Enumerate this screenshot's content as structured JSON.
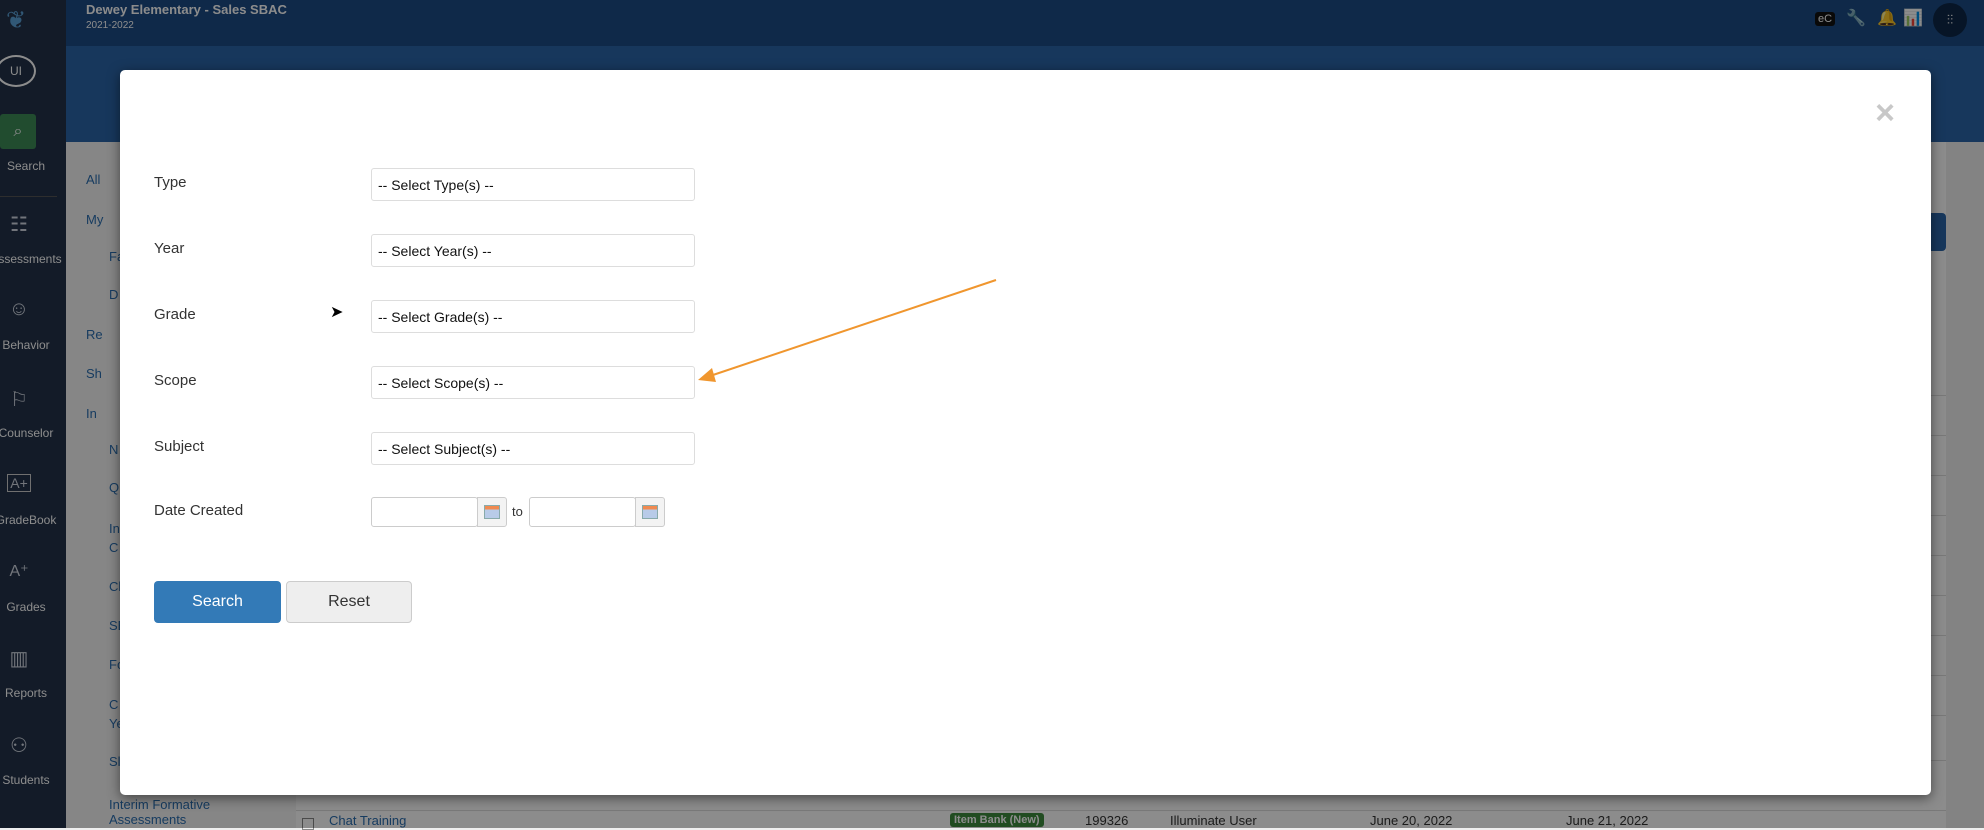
{
  "header": {
    "title": "Dewey Elementary - Sales SBAC",
    "year": "2021-2022",
    "icons": [
      "ec-icon",
      "wrench-icon",
      "bell-icon",
      "chart-icon",
      "sliders-icon"
    ],
    "ec_label": "eC"
  },
  "sidebar": {
    "avatar": "UI",
    "items": [
      {
        "label": "Search",
        "icon": "search-icon"
      },
      {
        "label": "Assessments",
        "icon": "assessment-icon"
      },
      {
        "label": "Behavior",
        "icon": "behavior-icon"
      },
      {
        "label": "Counselor",
        "icon": "counselor-icon"
      },
      {
        "label": "GradeBook",
        "icon": "gradebook-icon"
      },
      {
        "label": "Grades",
        "icon": "grades-icon"
      },
      {
        "label": "Reports",
        "icon": "reports-icon"
      },
      {
        "label": "Students",
        "icon": "students-icon"
      }
    ]
  },
  "leftnav": [
    "All",
    "My",
    "Fa",
    "D",
    "Re",
    "Sh",
    "In",
    "N",
    "Q",
    "In",
    "C",
    "Cl",
    "SE",
    "Fo",
    "C",
    "Ye",
    "Sl",
    "Interim Formative",
    "Assessments"
  ],
  "table_row": {
    "name": "Chat Training",
    "badge": "Item Bank (New)",
    "id": "199326",
    "author": "Illuminate User",
    "created": "June 20, 2022",
    "modified": "June 21, 2022"
  },
  "modal": {
    "fields": [
      {
        "label": "Type",
        "value": "-- Select Type(s) --"
      },
      {
        "label": "Year",
        "value": "-- Select Year(s) --"
      },
      {
        "label": "Grade",
        "value": "-- Select Grade(s) --"
      },
      {
        "label": "Scope",
        "value": "-- Select Scope(s) --"
      },
      {
        "label": "Subject",
        "value": "-- Select Subject(s) --"
      }
    ],
    "date_label": "Date Created",
    "date_to": "to",
    "date_from_value": "",
    "date_to_value": "",
    "search": "Search",
    "reset": "Reset",
    "close": "×"
  },
  "colors": {
    "primary": "#337ab7",
    "annotation_arrow": "#f0962e",
    "header": "#1d4c86"
  }
}
